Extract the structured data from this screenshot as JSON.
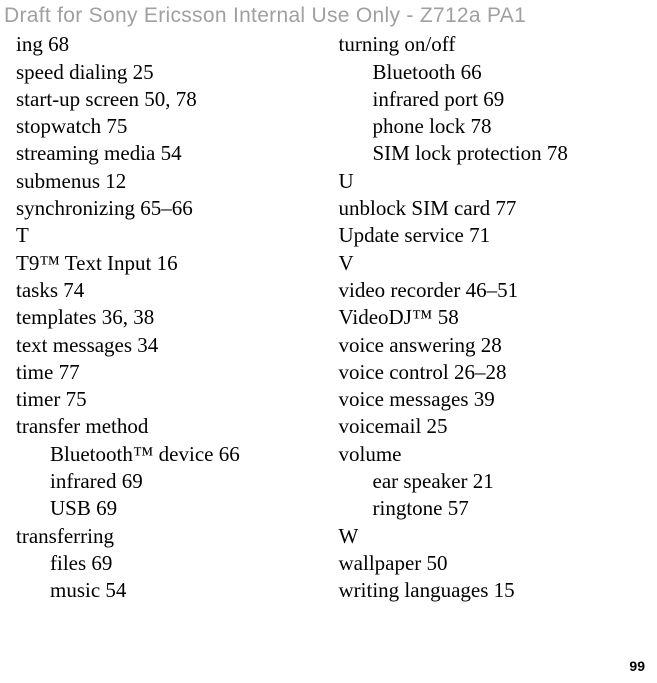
{
  "header": "Draft for Sony Ericsson Internal Use Only - Z712a PA1",
  "page_number": "99",
  "columns": {
    "left": [
      {
        "type": "entry",
        "text": "ing 68"
      },
      {
        "type": "entry",
        "text": "speed dialing 25"
      },
      {
        "type": "entry",
        "text": "start-up screen 50, 78"
      },
      {
        "type": "entry",
        "text": "stopwatch 75"
      },
      {
        "type": "entry",
        "text": "streaming media 54"
      },
      {
        "type": "entry",
        "text": "submenus 12"
      },
      {
        "type": "entry",
        "text": "synchronizing 65–66"
      },
      {
        "type": "heading",
        "text": "T"
      },
      {
        "type": "entry",
        "text": "T9™ Text Input 16"
      },
      {
        "type": "entry",
        "text": "tasks 74"
      },
      {
        "type": "entry",
        "text": "templates 36, 38"
      },
      {
        "type": "entry",
        "text": "text messages 34"
      },
      {
        "type": "entry",
        "text": "time 77"
      },
      {
        "type": "entry",
        "text": "timer 75"
      },
      {
        "type": "entry",
        "text": "transfer method"
      },
      {
        "type": "sub",
        "text": "Bluetooth™ device 66"
      },
      {
        "type": "sub",
        "text": "infrared 69"
      },
      {
        "type": "sub",
        "text": "USB 69"
      },
      {
        "type": "entry",
        "text": "transferring"
      },
      {
        "type": "sub",
        "text": "files 69"
      },
      {
        "type": "sub",
        "text": "music 54"
      }
    ],
    "right": [
      {
        "type": "entry",
        "text": "turning on/off"
      },
      {
        "type": "sub",
        "text": "Bluetooth 66"
      },
      {
        "type": "sub",
        "text": "infrared port 69"
      },
      {
        "type": "sub",
        "text": "phone lock 78"
      },
      {
        "type": "sub",
        "text": "SIM lock protection 78"
      },
      {
        "type": "heading",
        "text": "U"
      },
      {
        "type": "entry",
        "text": "unblock SIM card 77"
      },
      {
        "type": "entry",
        "text": "Update service 71"
      },
      {
        "type": "heading",
        "text": "V"
      },
      {
        "type": "entry",
        "text": "video recorder 46–51"
      },
      {
        "type": "entry",
        "text": "VideoDJ™ 58"
      },
      {
        "type": "entry",
        "text": "voice answering 28"
      },
      {
        "type": "entry",
        "text": "voice control 26–28"
      },
      {
        "type": "entry",
        "text": "voice messages 39"
      },
      {
        "type": "entry",
        "text": "voicemail 25"
      },
      {
        "type": "entry",
        "text": "volume"
      },
      {
        "type": "sub",
        "text": "ear speaker 21"
      },
      {
        "type": "sub",
        "text": "ringtone 57"
      },
      {
        "type": "heading",
        "text": "W"
      },
      {
        "type": "entry",
        "text": "wallpaper 50"
      },
      {
        "type": "entry",
        "text": "writing languages 15"
      }
    ]
  }
}
